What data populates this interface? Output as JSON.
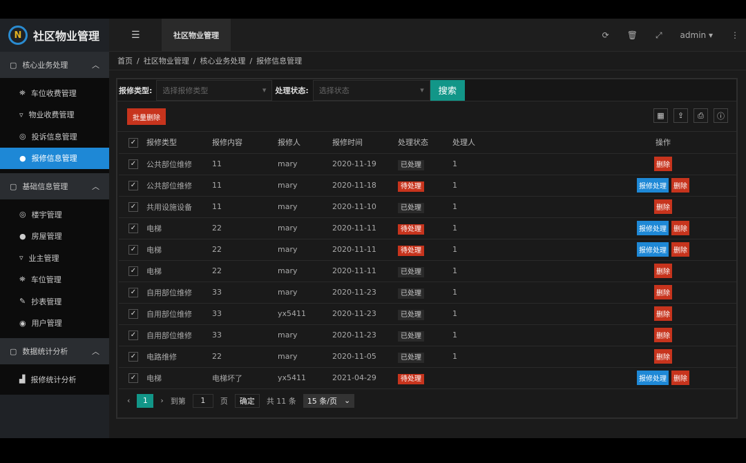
{
  "app": {
    "logo": "N",
    "title": "社区物业管理"
  },
  "topbar": {
    "tab": "社区物业管理",
    "user": "admin"
  },
  "sidebar": {
    "groups": [
      {
        "label": "核心业务处理",
        "items": [
          {
            "label": "车位收费管理"
          },
          {
            "label": "物业收费管理"
          },
          {
            "label": "投诉信息管理"
          },
          {
            "label": "报修信息管理"
          }
        ]
      },
      {
        "label": "基础信息管理",
        "items": [
          {
            "label": "楼宇管理"
          },
          {
            "label": "房屋管理"
          },
          {
            "label": "业主管理"
          },
          {
            "label": "车位管理"
          },
          {
            "label": "抄表管理"
          },
          {
            "label": "用户管理"
          }
        ]
      },
      {
        "label": "数据统计分析",
        "items": [
          {
            "label": "报修统计分析"
          }
        ]
      }
    ]
  },
  "breadcrumb": [
    "首页",
    "社区物业管理",
    "核心业务处理",
    "报修信息管理"
  ],
  "filter": {
    "type_label": "报修类型:",
    "type_placeholder": "选择报修类型",
    "status_label": "处理状态:",
    "status_placeholder": "选择状态",
    "search": "搜索"
  },
  "toolbar": {
    "bulk_delete": "批量删除"
  },
  "table": {
    "headers": [
      "报修类型",
      "报修内容",
      "报修人",
      "报修时间",
      "处理状态",
      "处理人",
      "操作"
    ],
    "rows": [
      [
        "公共部位维修",
        "11",
        "mary",
        "2020-11-19",
        "已处理",
        "1"
      ],
      [
        "公共部位维修",
        "11",
        "mary",
        "2020-11-18",
        "待处理",
        "1"
      ],
      [
        "共用设施设备",
        "11",
        "mary",
        "2020-11-10",
        "已处理",
        "1"
      ],
      [
        "电梯",
        "22",
        "mary",
        "2020-11-11",
        "待处理",
        "1"
      ],
      [
        "电梯",
        "22",
        "mary",
        "2020-11-11",
        "待处理",
        "1"
      ],
      [
        "电梯",
        "22",
        "mary",
        "2020-11-11",
        "已处理",
        "1"
      ],
      [
        "自用部位维修",
        "33",
        "mary",
        "2020-11-23",
        "已处理",
        "1"
      ],
      [
        "自用部位维修",
        "33",
        "yx5411",
        "2020-11-23",
        "已处理",
        "1"
      ],
      [
        "自用部位维修",
        "33",
        "mary",
        "2020-11-23",
        "已处理",
        "1"
      ],
      [
        "电路维修",
        "22",
        "mary",
        "2020-11-05",
        "已处理",
        "1"
      ],
      [
        "电梯",
        "电梯坏了",
        "yx5411",
        "2021-04-29",
        "待处理",
        ""
      ]
    ],
    "process_label": "报修处理",
    "delete_label": "删除",
    "pending_value": "待处理"
  },
  "pager": {
    "current": "1",
    "goto": "到第",
    "page_input": "1",
    "page_unit": "页",
    "confirm": "确定",
    "total": "共 11 条",
    "per_page": "15 条/页"
  }
}
